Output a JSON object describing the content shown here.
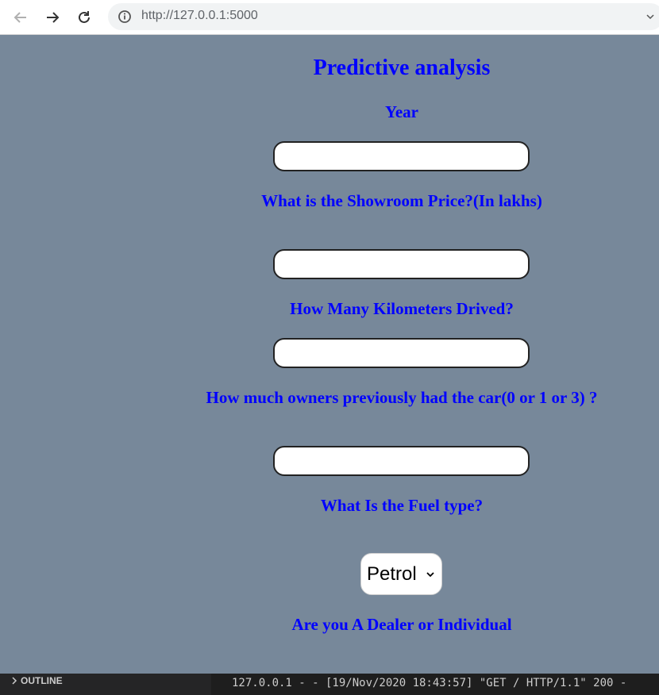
{
  "browser": {
    "url": "http://127.0.0.1:5000"
  },
  "page": {
    "title": "Predictive analysis",
    "fields": [
      {
        "label": "Year",
        "value": ""
      },
      {
        "label": "What is the Showroom Price?(In lakhs)",
        "value": ""
      },
      {
        "label": "How Many Kilometers Drived?",
        "value": ""
      },
      {
        "label": "How much owners previously had the car(0 or 1 or 3) ?",
        "value": ""
      }
    ],
    "fuel": {
      "label": "What Is the Fuel type?",
      "selected": "Petrol"
    },
    "seller_label": "Are you A Dealer or Individual"
  },
  "vscode": {
    "outline_label": "OUTLINE",
    "terminal_text": "127.0.0.1 - - [19/Nov/2020 18:43:57] \"GET / HTTP/1.1\" 200 -"
  },
  "colors": {
    "page_background": "#77889a",
    "heading_color": "#0000ff"
  }
}
